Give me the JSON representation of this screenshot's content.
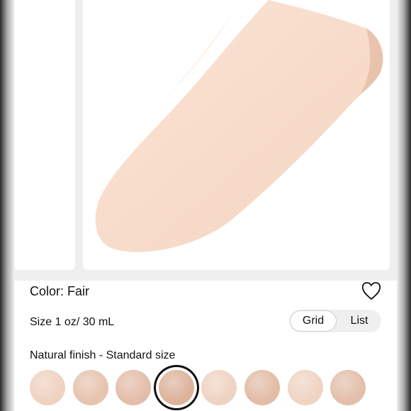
{
  "product": {
    "color_label": "Color: Fair",
    "size_label": "Size 1 oz/ 30 mL",
    "finish_label": "Natural finish - Standard size"
  },
  "view_toggle": {
    "grid_label": "Grid",
    "list_label": "List",
    "selected": "Grid"
  },
  "swatches": {
    "selected_index": 3,
    "items": [
      {
        "color": "#efd2c0"
      },
      {
        "color": "#e6c4ae"
      },
      {
        "color": "#e4bda9"
      },
      {
        "color": "#ddb39c"
      },
      {
        "color": "#efd3c2"
      },
      {
        "color": "#e2bca6"
      },
      {
        "color": "#efd4c3"
      },
      {
        "color": "#e3bfab"
      }
    ]
  },
  "icons": {
    "favorite": "heart-icon"
  },
  "colors": {
    "product_smear": "#f8dccb",
    "gallery_background": "#efefef",
    "selected_ring": "#111111"
  }
}
